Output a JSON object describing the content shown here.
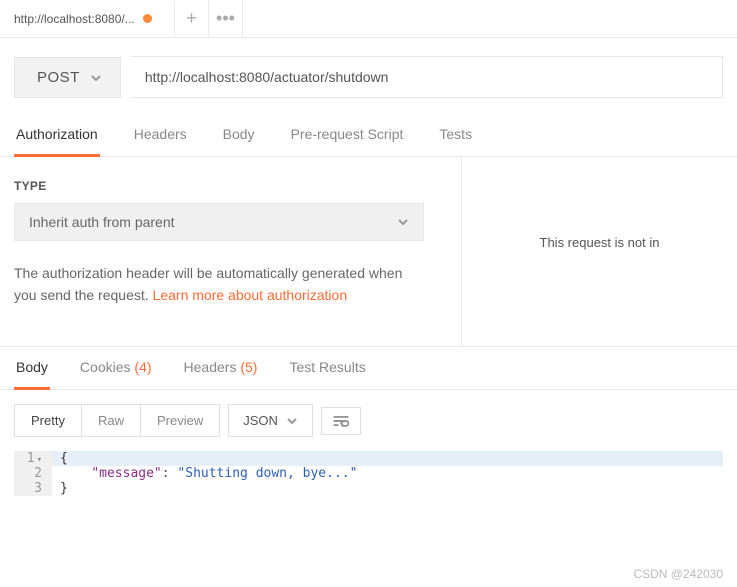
{
  "tab": {
    "label": "http://localhost:8080/..."
  },
  "request": {
    "method": "POST",
    "url": "http://localhost:8080/actuator/shutdown"
  },
  "sectionTabs": [
    "Authorization",
    "Headers",
    "Body",
    "Pre-request Script",
    "Tests"
  ],
  "auth": {
    "typeLabel": "TYPE",
    "selected": "Inherit auth from parent",
    "description": "The authorization header will be automatically generated when you send the request. ",
    "linkText": "Learn more about authorization"
  },
  "rightPane": {
    "text": "This request is not in"
  },
  "respTabs": {
    "body": "Body",
    "cookies": "Cookies",
    "cookiesCount": "(4)",
    "headers": "Headers",
    "headersCount": "(5)",
    "testResults": "Test Results"
  },
  "toolbar": {
    "pretty": "Pretty",
    "raw": "Raw",
    "preview": "Preview",
    "format": "JSON"
  },
  "response": {
    "line1": "{",
    "indent": "    ",
    "key": "\"message\"",
    "colon": ": ",
    "value": "\"Shutting down, bye...\"",
    "line3": "}"
  },
  "watermark": "CSDN @242030"
}
